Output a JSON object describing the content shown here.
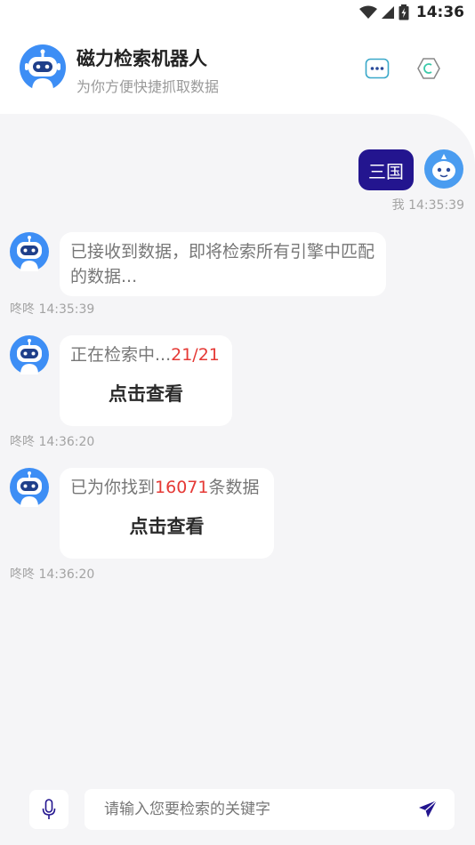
{
  "status_bar": {
    "time": "14:36"
  },
  "header": {
    "title": "磁力检索机器人",
    "subtitle": "为你方便快捷抓取数据",
    "more_icon": "more-dots-icon",
    "settings_icon": "hexagon-icon"
  },
  "colors": {
    "user_bubble": "#23158f",
    "highlight": "#e53935",
    "bot_avatar": "#3d8ef5",
    "chat_bg": "#f5f5f7"
  },
  "messages": [
    {
      "sender": "user",
      "text": "三国",
      "meta": "我 14:35:39"
    },
    {
      "sender": "bot",
      "text": "已接收到数据，即将检索所有引擎中匹配的数据...",
      "meta": "咚咚 14:35:39"
    },
    {
      "sender": "bot",
      "text_prefix": "正在检索中...",
      "highlight": "21/21",
      "action": "点击查看",
      "meta": "咚咚 14:36:20"
    },
    {
      "sender": "bot",
      "text_prefix": "已为你找到",
      "highlight": "16071",
      "text_suffix": "条数据",
      "action": "点击查看",
      "meta": "咚咚 14:36:20"
    }
  ],
  "input": {
    "placeholder": "请输入您要检索的关键字",
    "voice_icon": "microphone-icon",
    "send_icon": "send-icon"
  }
}
